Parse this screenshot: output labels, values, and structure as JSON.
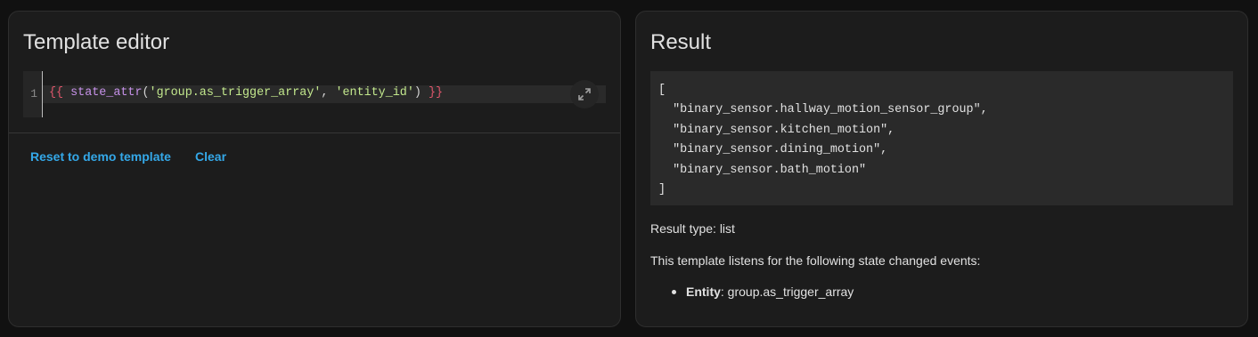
{
  "editor_card": {
    "title": "Template editor",
    "line_number": "1",
    "code_tokens": {
      "open_brace": "{{",
      "fn_name": "state_attr",
      "open_paren": "(",
      "arg1": "'group.as_trigger_array'",
      "comma": ", ",
      "arg2": "'entity_id'",
      "close_paren": ")",
      "close_brace": "}}"
    },
    "expand_icon": "fullscreen-icon",
    "reset_label": "Reset to demo template",
    "clear_label": "Clear"
  },
  "result_card": {
    "title": "Result",
    "result_lines": [
      "[",
      "  \"binary_sensor.hallway_motion_sensor_group\",",
      "  \"binary_sensor.kitchen_motion\",",
      "  \"binary_sensor.dining_motion\",",
      "  \"binary_sensor.bath_motion\"",
      "]"
    ],
    "result_type_label": "Result type: list",
    "listen_text": "This template listens for the following state changed events:",
    "listeners": [
      {
        "label": "Entity",
        "value": ": group.as_trigger_array"
      }
    ]
  },
  "colors": {
    "accent": "#34a8e8",
    "card_bg": "#1c1c1c",
    "page_bg": "#111111",
    "code_brace": "#e0566b",
    "code_fn": "#c792ea",
    "code_string": "#c3e88d"
  }
}
